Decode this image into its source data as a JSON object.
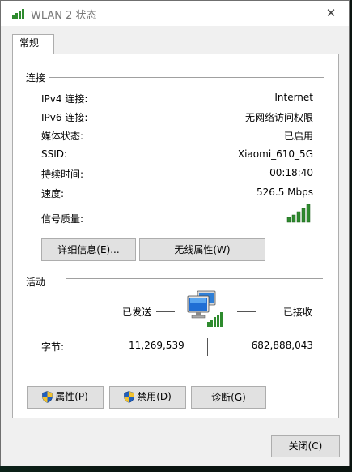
{
  "window": {
    "title": "WLAN 2 状态",
    "close_icon": "close-icon"
  },
  "tabs": [
    {
      "label": "常规",
      "selected": true
    }
  ],
  "connection": {
    "section_label": "连接",
    "rows": [
      {
        "label": "IPv4 连接:",
        "value": "Internet"
      },
      {
        "label": "IPv6 连接:",
        "value": "无网络访问权限"
      },
      {
        "label": "媒体状态:",
        "value": "已启用"
      },
      {
        "label": "SSID:",
        "value": "Xiaomi_610_5G"
      },
      {
        "label": "持续时间:",
        "value": "00:18:40"
      },
      {
        "label": "速度:",
        "value": "526.5 Mbps"
      }
    ],
    "signal_label": "信号质量:",
    "signal_bars_total": 5,
    "signal_bars_filled": 5,
    "details_button": "详细信息(E)...",
    "wireless_button": "无线属性(W)"
  },
  "activity": {
    "section_label": "活动",
    "sent_label": "已发送",
    "received_label": "已接收",
    "bytes_label": "字节:",
    "bytes_sent": "11,269,539",
    "bytes_received": "682,888,043"
  },
  "buttons": {
    "properties": "属性(P)",
    "disable": "禁用(D)",
    "diagnose": "诊断(G)",
    "close": "关闭(C)"
  },
  "colors": {
    "signal_green": "#2e8b2e",
    "window_bg": "#f0f0f0",
    "button_bg": "#e1e1e1"
  }
}
